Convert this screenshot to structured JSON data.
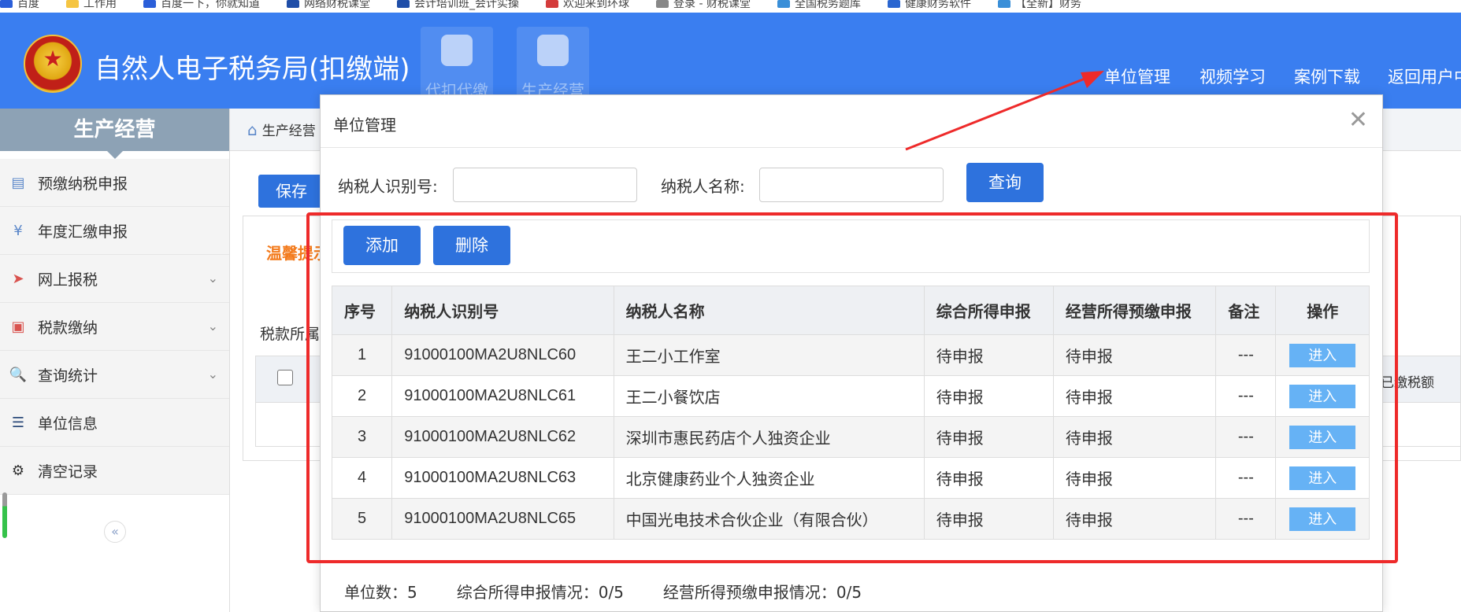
{
  "bookmarks": [
    {
      "label": "百度",
      "icon": "paw-icon",
      "color": "#2b5fd9"
    },
    {
      "label": "工作用",
      "icon": "folder-icon",
      "color": "#f5c542"
    },
    {
      "label": "百度一下，你就知道",
      "icon": "paw-icon",
      "color": "#2b5fd9"
    },
    {
      "label": "网络财税课堂",
      "icon": "tax-icon",
      "color": "#1f4ea8"
    },
    {
      "label": "会计培训班_会计实操",
      "icon": "tax-icon",
      "color": "#1f4ea8"
    },
    {
      "label": "欢迎来到环球",
      "icon": "globe-icon",
      "color": "#d43c3c"
    },
    {
      "label": "登录 - 财税课堂",
      "icon": "globe-icon",
      "color": "#888888"
    },
    {
      "label": "全国税务题库",
      "icon": "doc-icon",
      "color": "#3a8fd8"
    },
    {
      "label": "健康财务软件",
      "icon": "ok-icon",
      "color": "#2a66d0"
    },
    {
      "label": "【全新】财务",
      "icon": "doc-icon",
      "color": "#3a8fd8"
    }
  ],
  "header": {
    "title": "自然人电子税务局(扣缴端)",
    "modules": [
      {
        "label": "代扣代缴",
        "icon": "wallet-icon"
      },
      {
        "label": "生产经营",
        "icon": "coins-icon"
      }
    ],
    "nav": [
      "单位管理",
      "视频学习",
      "案例下载",
      "返回用户中心"
    ]
  },
  "sidebar": {
    "title": "生产经营",
    "items": [
      {
        "label": "预缴纳税申报",
        "icon": "clipboard-icon",
        "expandable": false
      },
      {
        "label": "年度汇缴申报",
        "icon": "yen-icon",
        "expandable": false
      },
      {
        "label": "网上报税",
        "icon": "send-icon",
        "expandable": true
      },
      {
        "label": "税款缴纳",
        "icon": "monitor-icon",
        "expandable": true
      },
      {
        "label": "查询统计",
        "icon": "search-doc-icon",
        "expandable": true
      },
      {
        "label": "单位信息",
        "icon": "list-icon",
        "expandable": false
      },
      {
        "label": "清空记录",
        "icon": "gear-icon",
        "expandable": false
      }
    ]
  },
  "main": {
    "breadcrumb": "生产经营",
    "save_label": "保存",
    "warm_tip": "温馨提示",
    "tax_label": "税款所属",
    "bg_col_right": "已缴税额"
  },
  "modal": {
    "title": "单位管理",
    "search": {
      "id_label": "纳税人识别号:",
      "id_value": "",
      "name_label": "纳税人名称:",
      "name_value": "",
      "query_label": "查询"
    },
    "toolbar": {
      "add_label": "添加",
      "delete_label": "删除"
    },
    "columns": [
      "序号",
      "纳税人识别号",
      "纳税人名称",
      "综合所得申报",
      "经营所得预缴申报",
      "备注",
      "操作"
    ],
    "rows": [
      {
        "no": "1",
        "id": "91000100MA2U8NLC60",
        "name": "王二小工作室",
        "comprehensive": "待申报",
        "business": "待申报",
        "note": "---",
        "action": "进入"
      },
      {
        "no": "2",
        "id": "91000100MA2U8NLC61",
        "name": "王二小餐饮店",
        "comprehensive": "待申报",
        "business": "待申报",
        "note": "---",
        "action": "进入"
      },
      {
        "no": "3",
        "id": "91000100MA2U8NLC62",
        "name": "深圳市惠民药店个人独资企业",
        "comprehensive": "待申报",
        "business": "待申报",
        "note": "---",
        "action": "进入"
      },
      {
        "no": "4",
        "id": "91000100MA2U8NLC63",
        "name": "北京健康药业个人独资企业",
        "comprehensive": "待申报",
        "business": "待申报",
        "note": "---",
        "action": "进入"
      },
      {
        "no": "5",
        "id": "91000100MA2U8NLC65",
        "name": "中国光电技术合伙企业（有限合伙）",
        "comprehensive": "待申报",
        "business": "待申报",
        "note": "---",
        "action": "进入"
      }
    ],
    "summary": {
      "units": "单位数：5",
      "comprehensive": "综合所得申报情况：0/5",
      "business": "经营所得预缴申报情况：0/5"
    }
  },
  "colors": {
    "header_blue": "#3a7ef0",
    "button_blue": "#2e72dd",
    "enter_button": "#66b2f5",
    "annotation_red": "#ee2a2a",
    "warm_orange": "#f37b1d"
  }
}
